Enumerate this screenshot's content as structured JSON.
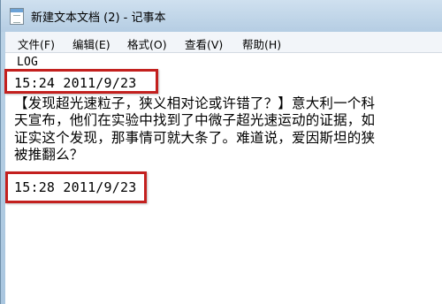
{
  "window": {
    "title": "新建文本文档 (2) - 记事本"
  },
  "menu": {
    "items": [
      {
        "label": "文件(F)"
      },
      {
        "label": "编辑(E)"
      },
      {
        "label": "格式(O)"
      },
      {
        "label": "查看(V)"
      },
      {
        "label": "帮助(H)"
      }
    ]
  },
  "editor": {
    "lines": [
      "LOG",
      "15:24 2011/9/23",
      "【发现超光速粒子，狭义相对论或许错了？】意大利一个科",
      "天宣布，他们在实验中找到了中微子超光速运动的证据，如",
      "证实这个发现，那事情可就大条了。难道说，爱因斯坦的狭",
      "被推翻么？",
      "",
      "15:28 2011/9/23"
    ]
  },
  "highlight": {
    "color": "#c3201e"
  }
}
